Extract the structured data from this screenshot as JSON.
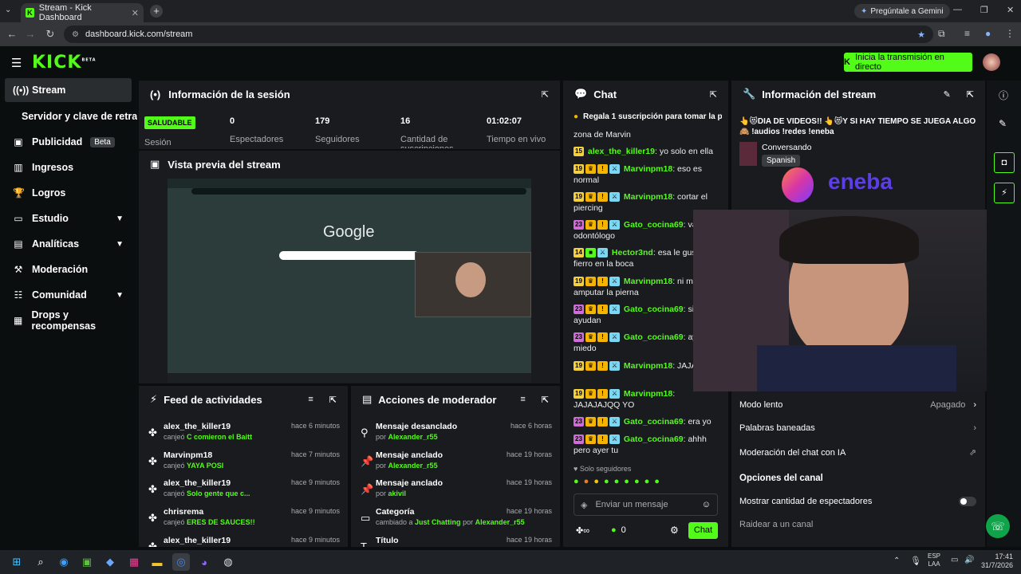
{
  "browser": {
    "tab_title": "Stream - Kick Dashboard",
    "new_tab": "+",
    "url": "dashboard.kick.com/stream",
    "gemini": "Pregúntale a Gemini"
  },
  "header": {
    "logo": "KICK",
    "logo_sup": "BETA",
    "go_live": "Inicia la transmisión en directo"
  },
  "sidebar": {
    "items": [
      {
        "label": "Stream"
      },
      {
        "label": "Servidor y clave de retransmisión"
      },
      {
        "label": "Publicidad",
        "badge": "Beta"
      },
      {
        "label": "Ingresos"
      },
      {
        "label": "Logros"
      },
      {
        "label": "Estudio"
      },
      {
        "label": "Analíticas"
      },
      {
        "label": "Moderación"
      },
      {
        "label": "Comunidad"
      },
      {
        "label": "Drops y recompensas"
      }
    ]
  },
  "session": {
    "title": "Información de la sesión",
    "health": "SALUDABLE",
    "health_label": "Sesión",
    "stats": [
      {
        "value": "0",
        "label": "Espectadores"
      },
      {
        "value": "179",
        "label": "Seguidores"
      },
      {
        "value": "16",
        "label": "Cantidad de suscripciones"
      },
      {
        "value": "01:02:07",
        "label": "Tiempo en vivo"
      }
    ]
  },
  "preview": {
    "title": "Vista previa del stream",
    "google": "Google"
  },
  "feed": {
    "title": "Feed de actividades",
    "items": [
      {
        "name": "alex_the_killer19",
        "time": "hace 6 minutos",
        "action": "canjeó",
        "reward": "C comieron el Baitt"
      },
      {
        "name": "Marvinpm18",
        "time": "hace 7 minutos",
        "action": "canjeó",
        "reward": "YAYA POSI"
      },
      {
        "name": "alex_the_killer19",
        "time": "hace 9 minutos",
        "action": "canjeó",
        "reward": "Solo gente que c..."
      },
      {
        "name": "chrisrema",
        "time": "hace 9 minutos",
        "action": "canjeó",
        "reward": "ERES DE SAUCES!!"
      },
      {
        "name": "alex_the_killer19",
        "time": "hace 9 minutos",
        "action": "",
        "reward": ""
      }
    ]
  },
  "mod": {
    "title": "Acciones de moderador",
    "items": [
      {
        "name": "Mensaje desanclado",
        "time": "hace 6 horas",
        "pre": "por",
        "user": "Alexander_r55",
        "mid": "",
        "user2": ""
      },
      {
        "name": "Mensaje anclado",
        "time": "hace 19 horas",
        "pre": "por",
        "user": "Alexander_r55",
        "mid": "",
        "user2": ""
      },
      {
        "name": "Mensaje anclado",
        "time": "hace 19 horas",
        "pre": "por",
        "user": "akivil",
        "mid": "",
        "user2": ""
      },
      {
        "name": "Categoría",
        "time": "hace 19 horas",
        "pre": "cambiado a",
        "user": "Just Chatting",
        "mid": "por",
        "user2": "Alexander_r55"
      },
      {
        "name": "Título",
        "time": "hace 19 horas",
        "pre": "",
        "user": "",
        "mid": "",
        "user2": ""
      }
    ]
  },
  "chat": {
    "title": "Chat",
    "pinned": "Regala 1 suscripción para tomar la p",
    "top_text": "zona de Marvin",
    "messages": [
      {
        "badge": "15",
        "name": "alex_the_killer19",
        "color": "#53fc18",
        "text": "yo solo en ella"
      },
      {
        "badge": "19",
        "name": "Marvinpm18",
        "color": "#53fc18",
        "text": "eso es normal"
      },
      {
        "badge": "19",
        "name": "Marvinpm18",
        "color": "#53fc18",
        "text": "cortar el piercing"
      },
      {
        "badge": "23",
        "name": "Gato_cocina69",
        "color": "#53fc18",
        "text": "vas odontólogo"
      },
      {
        "badge": "14",
        "name": "Hector3nd",
        "color": "#53fc18",
        "text": "esa le gusta fierro en la boca"
      },
      {
        "badge": "19",
        "name": "Marvinpm18",
        "color": "#53fc18",
        "text": "ni mod amputar la pierna"
      },
      {
        "badge": "23",
        "name": "Gato_cocina69",
        "color": "#53fc18",
        "text": "si te ayudan"
      },
      {
        "badge": "23",
        "name": "Gato_cocina69",
        "color": "#53fc18",
        "text": "ay r que miedo"
      },
      {
        "badge": "19",
        "name": "Marvinpm18",
        "color": "#53fc18",
        "text": "JAJAJ YO"
      },
      {
        "badge": "19",
        "name": "Marvinpm18",
        "color": "#53fc18",
        "text": "JAJAJAJQQ YO"
      },
      {
        "badge": "23",
        "name": "Gato_cocina69",
        "color": "#53fc18",
        "text": "era yo"
      },
      {
        "badge": "23",
        "name": "Gato_cocina69",
        "color": "#53fc18",
        "text": "ahhh pero ayer tu"
      }
    ],
    "followers_only": "Solo seguidores",
    "placeholder": "Enviar un mensaje",
    "points": "0",
    "send": "Chat"
  },
  "stream_info": {
    "title": "Información del stream",
    "stream_title": "👆😻DIA DE VIDEOS!! 👆😻Y SI HAY TIEMPO SE JUEGA ALGO🙈 !audios !redes !eneba",
    "category": "Conversando",
    "language": "Spanish",
    "sponsor": "eneba",
    "slow_mode": "Modo lento",
    "slow_mode_value": "Apagado",
    "banned_words": "Palabras baneadas",
    "ai_mod": "Moderación del chat con IA",
    "channel_options": "Opciones del canal",
    "show_viewers": "Mostrar cantidad de espectadores",
    "raid": "Raidear a un canal"
  },
  "taskbar": {
    "lang1": "ESP",
    "lang2": "LAA",
    "time": "17:41",
    "date": "31/7/2026"
  }
}
